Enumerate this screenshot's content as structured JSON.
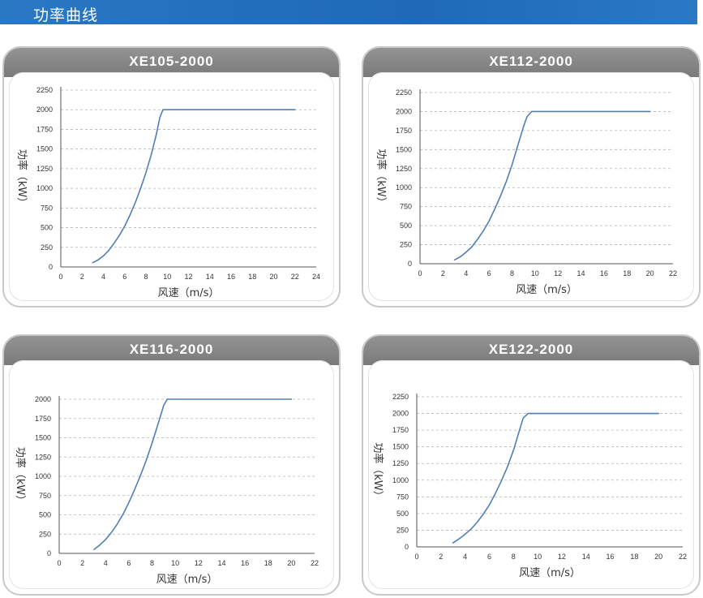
{
  "page": {
    "title": "功率曲线"
  },
  "chart_data": [
    {
      "type": "line",
      "title": "XE105-2000",
      "xlabel": "风速（m/s）",
      "ylabel": "功率（kW）",
      "xlim": [
        0,
        24
      ],
      "ylim": [
        0,
        2250
      ],
      "xticks": [
        0,
        2,
        4,
        6,
        8,
        10,
        12,
        14,
        16,
        18,
        20,
        22,
        24
      ],
      "yticks": [
        0,
        250,
        500,
        750,
        1000,
        1250,
        1500,
        1750,
        2000,
        2250
      ],
      "grid": "horizontal-dashed",
      "series": [
        {
          "color": "#4f7fb5",
          "x": [
            3,
            3.5,
            4,
            4.5,
            5,
            5.5,
            6,
            6.5,
            7,
            7.5,
            8,
            8.5,
            9,
            9.3,
            9.6,
            10,
            22
          ],
          "y": [
            55,
            90,
            140,
            210,
            300,
            400,
            520,
            660,
            820,
            1000,
            1200,
            1430,
            1700,
            1900,
            2000,
            2000,
            2000
          ]
        }
      ]
    },
    {
      "type": "line",
      "title": "XE112-2000",
      "xlabel": "风速（m/s）",
      "ylabel": "功率（kW）",
      "xlim": [
        0,
        22
      ],
      "ylim": [
        0,
        2250
      ],
      "xticks": [
        0,
        2,
        4,
        6,
        8,
        10,
        12,
        14,
        16,
        18,
        20,
        22
      ],
      "yticks": [
        0,
        250,
        500,
        750,
        1000,
        1250,
        1500,
        1750,
        2000,
        2250
      ],
      "grid": "horizontal-dashed",
      "series": [
        {
          "color": "#4f7fb5",
          "x": [
            3,
            3.5,
            4,
            4.5,
            5,
            5.5,
            6,
            6.5,
            7,
            7.5,
            8,
            8.5,
            9,
            9.3,
            9.7,
            10,
            20
          ],
          "y": [
            50,
            90,
            150,
            220,
            320,
            430,
            560,
            720,
            890,
            1080,
            1300,
            1550,
            1800,
            1930,
            2000,
            2000,
            2000
          ]
        }
      ]
    },
    {
      "type": "line",
      "title": "XE116-2000",
      "xlabel": "风速（m/s）",
      "ylabel": "功率（kW）",
      "xlim": [
        0,
        22
      ],
      "ylim": [
        0,
        2000
      ],
      "xticks": [
        0,
        2,
        4,
        6,
        8,
        10,
        12,
        14,
        16,
        18,
        20,
        22
      ],
      "yticks": [
        0,
        250,
        500,
        750,
        1000,
        1250,
        1500,
        1750,
        2000
      ],
      "grid": "horizontal-dashed",
      "series": [
        {
          "color": "#4f7fb5",
          "x": [
            3,
            3.5,
            4,
            4.5,
            5,
            5.5,
            6,
            6.5,
            7,
            7.5,
            8,
            8.5,
            9,
            9.3,
            10,
            20
          ],
          "y": [
            50,
            110,
            180,
            270,
            380,
            510,
            660,
            830,
            1010,
            1210,
            1430,
            1670,
            1920,
            2000,
            2000,
            2000
          ]
        }
      ]
    },
    {
      "type": "line",
      "title": "XE122-2000",
      "xlabel": "风速（m/s）",
      "ylabel": "功率（kW）",
      "xlim": [
        0,
        22
      ],
      "ylim": [
        0,
        2250
      ],
      "xticks": [
        0,
        2,
        4,
        6,
        8,
        10,
        12,
        14,
        16,
        18,
        20,
        22
      ],
      "yticks": [
        0,
        250,
        500,
        750,
        1000,
        1250,
        1500,
        1750,
        2000,
        2250
      ],
      "grid": "horizontal-dashed",
      "series": [
        {
          "color": "#4f7fb5",
          "x": [
            3,
            3.5,
            4,
            4.5,
            5,
            5.5,
            6,
            6.5,
            7,
            7.5,
            8,
            8.5,
            8.8,
            9.2,
            10,
            20
          ],
          "y": [
            60,
            120,
            190,
            270,
            370,
            490,
            630,
            800,
            990,
            1200,
            1450,
            1750,
            1930,
            2000,
            2000,
            2000
          ]
        }
      ]
    }
  ]
}
